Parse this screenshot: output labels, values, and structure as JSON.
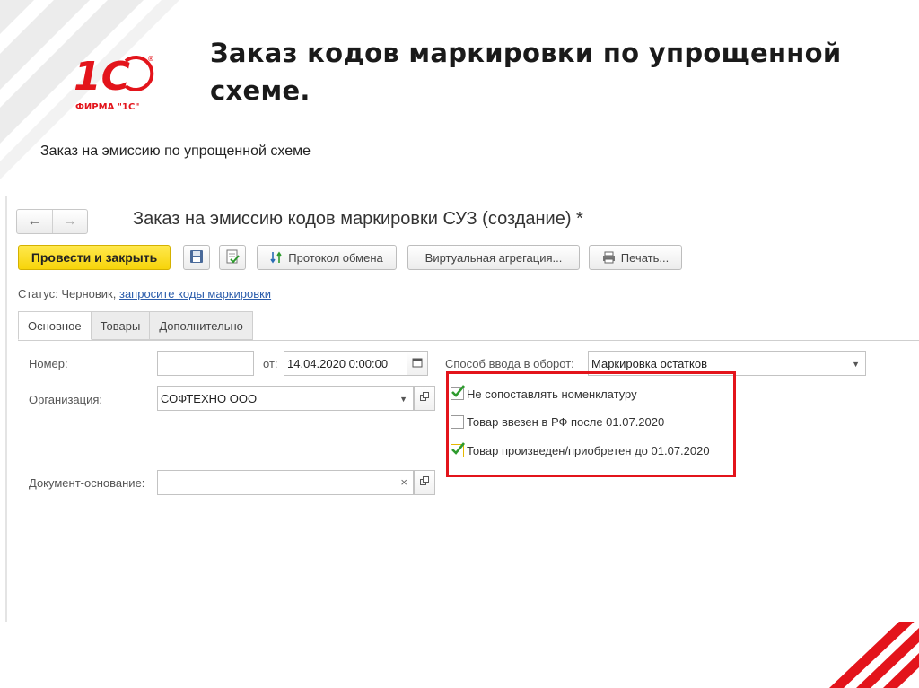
{
  "slide": {
    "title": "Заказ кодов маркировки по упрощенной схеме.",
    "subtitle": "Заказ на эмиссию по упрощенной схеме",
    "logo_text": "ФИРМА \"1С\"",
    "accent_color": "#e3141b"
  },
  "window": {
    "title": "Заказ на эмиссию кодов маркировки СУЗ (создание) *",
    "nav_back_icon": "arrow-left-icon",
    "nav_forward_icon": "arrow-right-icon"
  },
  "toolbar": {
    "post_and_close": "Провести и закрыть",
    "save_icon": "floppy-disk-icon",
    "post_icon": "document-post-icon",
    "exchange_log": "Протокол обмена",
    "virtual_aggregation": "Виртуальная агрегация...",
    "print": "Печать..."
  },
  "status": {
    "label": "Статус:",
    "value": "Черновик,",
    "link": "запросите коды маркировки"
  },
  "tabs": [
    {
      "label": "Основное",
      "active": true
    },
    {
      "label": "Товары",
      "active": false
    },
    {
      "label": "Дополнительно",
      "active": false
    }
  ],
  "form": {
    "number_label": "Номер:",
    "number_value": "",
    "date_label": "от:",
    "date_value": "14.04.2020  0:00:00",
    "organization_label": "Организация:",
    "organization_value": "СОФТЕХНО ООО",
    "basis_label": "Документ-основание:",
    "basis_value": "",
    "input_method_label": "Способ ввода в оборот:",
    "input_method_value": "Маркировка остатков"
  },
  "checkboxes": [
    {
      "label": "Не сопоставлять номенклатуру",
      "checked": true
    },
    {
      "label": "Товар ввезен в РФ после 01.07.2020",
      "checked": false
    },
    {
      "label": "Товар произведен/приобретен до 01.07.2020",
      "checked": true
    }
  ]
}
